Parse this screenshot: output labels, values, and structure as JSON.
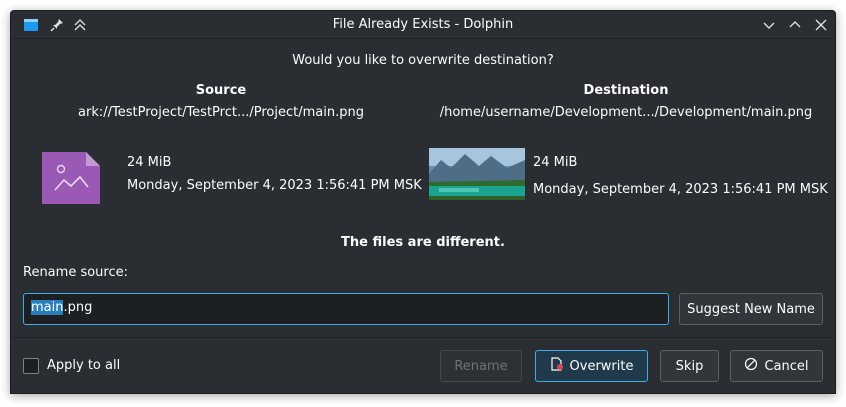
{
  "titlebar": {
    "title": "File Already Exists - Dolphin",
    "icons": [
      "folder-icon",
      "pin-icon",
      "keep-above-icon",
      "minimize-icon",
      "maximize-icon",
      "close-icon"
    ]
  },
  "dialog": {
    "heading": "Would you like to overwrite destination?",
    "source": {
      "title": "Source",
      "path": "ark://TestProject/TestPrct.../Project/main.png",
      "size": "24 MiB",
      "date": "Monday, September 4, 2023 1:56:41 PM MSK"
    },
    "destination": {
      "title": "Destination",
      "path": "/home/username/Development.../Development/main.png",
      "size": "24 MiB",
      "date": "Monday, September 4, 2023 1:56:41 PM MSK"
    },
    "difference_note": "The files are different.",
    "rename_label": "Rename source:",
    "rename_value_selected": "main",
    "rename_value_rest": ".png",
    "suggest_button": "Suggest New Name"
  },
  "footer": {
    "apply_all_label": "Apply to all",
    "apply_all_checked": false,
    "rename_button": "Rename",
    "overwrite_button": "Overwrite",
    "skip_button": "Skip",
    "cancel_button": "Cancel"
  },
  "colors": {
    "window_bg": "#2a2e32",
    "accent": "#3daee9",
    "text": "#fcfcfc"
  }
}
